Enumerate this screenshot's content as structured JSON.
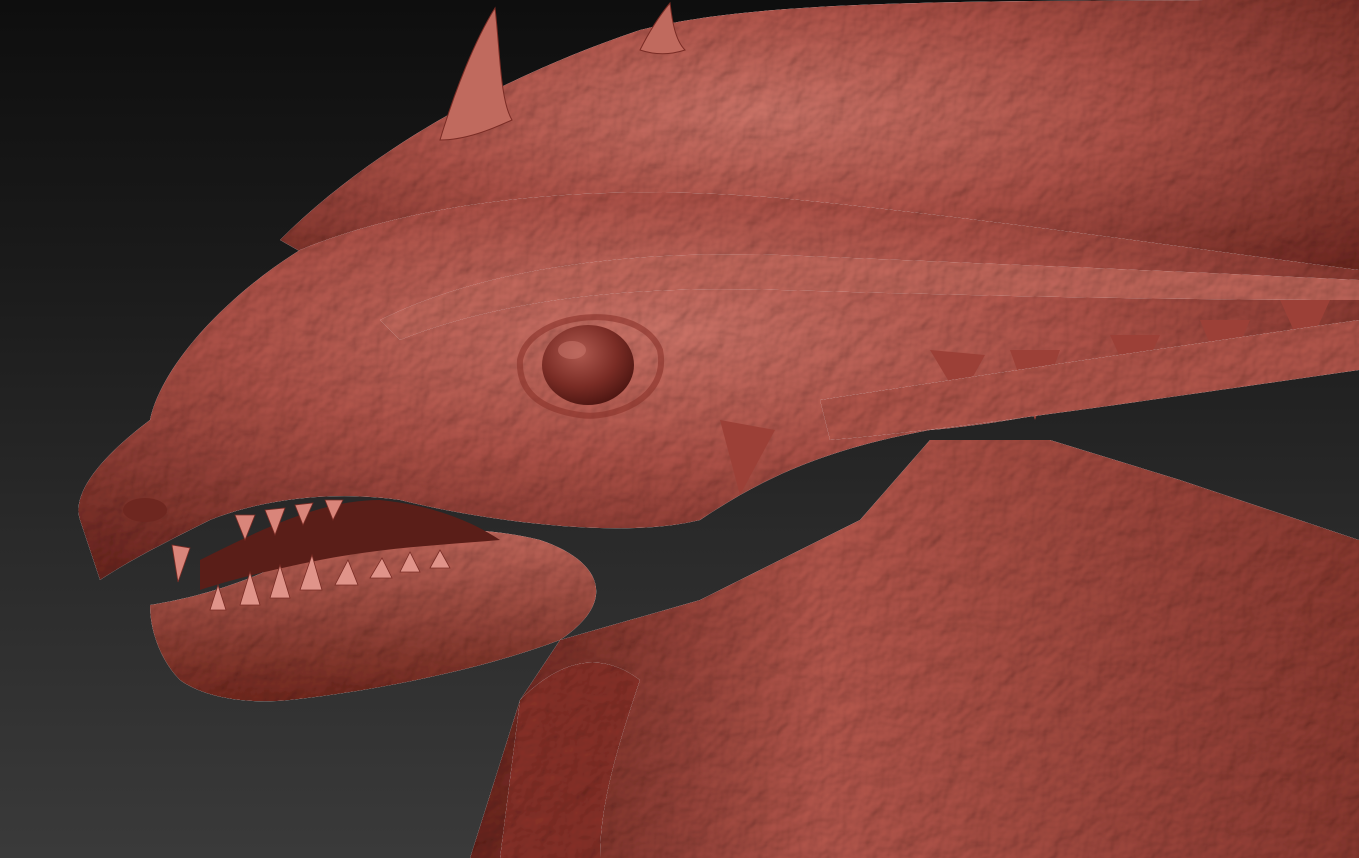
{
  "canvas": {
    "background_top": "#0e0e0e",
    "background_bottom": "#3a3a3a"
  },
  "model": {
    "subject": "dragon-head-sculpt",
    "clay_color": "#a8473c",
    "clay_highlight": "#d97e6f",
    "clay_shadow": "#5a1e18",
    "eye_color": "#7a2c25"
  }
}
